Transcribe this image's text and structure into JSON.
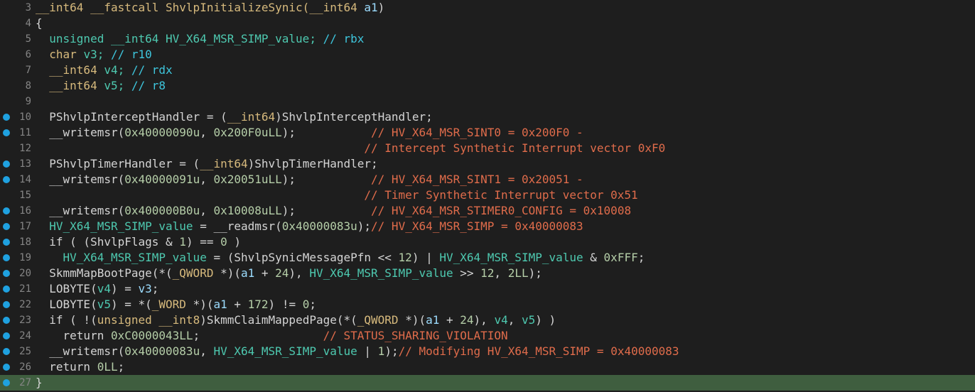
{
  "colors": {
    "background": "#1e1e1e",
    "line_number": "#858585",
    "breakpoint_dot": "#1fa1e0",
    "current_line_bg": "#3f5e3f",
    "plain": "#d4d4d4",
    "keyword": "#4ec9b0",
    "type": "#d7ba7d",
    "number": "#b5cea8",
    "comment_cyan": "#3ec6dd",
    "comment_orange": "#e06c4b",
    "global": "#2fb6e8",
    "variable": "#9cdcfe"
  },
  "icons": {
    "breakpoint": "breakpoint-dot-icon"
  },
  "lines": [
    {
      "num": "3",
      "bp": false,
      "hl": false,
      "tokens": [
        {
          "t": "__int64 __fastcall ShvlpInitializeSynic(",
          "c": "type"
        },
        {
          "t": "__int64 ",
          "c": "type"
        },
        {
          "t": "a1",
          "c": "variable"
        },
        {
          "t": ")",
          "c": "plain"
        }
      ]
    },
    {
      "num": "4",
      "bp": false,
      "hl": false,
      "tokens": [
        {
          "t": "{",
          "c": "plain"
        }
      ]
    },
    {
      "num": "5",
      "bp": false,
      "hl": false,
      "tokens": [
        {
          "t": "  unsigned __int64 HV_X64_MSR_SIMP_value; ",
          "c": "keyword"
        },
        {
          "t": "// rbx",
          "c": "comment_cyan"
        }
      ]
    },
    {
      "num": "6",
      "bp": false,
      "hl": false,
      "tokens": [
        {
          "t": "  char ",
          "c": "type"
        },
        {
          "t": "v3; ",
          "c": "keyword"
        },
        {
          "t": "// r10",
          "c": "comment_cyan"
        }
      ]
    },
    {
      "num": "7",
      "bp": false,
      "hl": false,
      "tokens": [
        {
          "t": "  __int64 ",
          "c": "type"
        },
        {
          "t": "v4; ",
          "c": "keyword"
        },
        {
          "t": "// rdx",
          "c": "comment_cyan"
        }
      ]
    },
    {
      "num": "8",
      "bp": false,
      "hl": false,
      "tokens": [
        {
          "t": "  __int64 ",
          "c": "type"
        },
        {
          "t": "v5; ",
          "c": "keyword"
        },
        {
          "t": "// r8",
          "c": "comment_cyan"
        }
      ]
    },
    {
      "num": "9",
      "bp": false,
      "hl": false,
      "tokens": []
    },
    {
      "num": "10",
      "bp": true,
      "hl": false,
      "tokens": [
        {
          "t": "  PShvlpInterceptHandler = (",
          "c": "plain"
        },
        {
          "t": "__int64",
          "c": "type"
        },
        {
          "t": ")ShvlpInterceptHandler;",
          "c": "plain"
        }
      ]
    },
    {
      "num": "11",
      "bp": true,
      "hl": false,
      "tokens": [
        {
          "t": "  __writemsr(",
          "c": "plain"
        },
        {
          "t": "0x40000090u",
          "c": "number"
        },
        {
          "t": ", ",
          "c": "plain"
        },
        {
          "t": "0x200F0uLL",
          "c": "number"
        },
        {
          "t": ");           ",
          "c": "plain"
        },
        {
          "t": "// HV_X64_MSR_SINT0 = 0x200F0 -",
          "c": "comment_orange"
        }
      ]
    },
    {
      "num": "12",
      "bp": false,
      "hl": false,
      "tokens": [
        {
          "t": "                                                ",
          "c": "plain"
        },
        {
          "t": "// Intercept Synthetic Interrupt vector 0xF0",
          "c": "comment_orange"
        }
      ]
    },
    {
      "num": "13",
      "bp": true,
      "hl": false,
      "tokens": [
        {
          "t": "  PShvlpTimerHandler = (",
          "c": "plain"
        },
        {
          "t": "__int64",
          "c": "type"
        },
        {
          "t": ")ShvlpTimerHandler;",
          "c": "plain"
        }
      ]
    },
    {
      "num": "14",
      "bp": true,
      "hl": false,
      "tokens": [
        {
          "t": "  __writemsr(",
          "c": "plain"
        },
        {
          "t": "0x40000091u",
          "c": "number"
        },
        {
          "t": ", ",
          "c": "plain"
        },
        {
          "t": "0x20051uLL",
          "c": "number"
        },
        {
          "t": ");           ",
          "c": "plain"
        },
        {
          "t": "// HV_X64_MSR_SINT1 = 0x20051 -",
          "c": "comment_orange"
        }
      ]
    },
    {
      "num": "15",
      "bp": false,
      "hl": false,
      "tokens": [
        {
          "t": "                                                ",
          "c": "plain"
        },
        {
          "t": "// Timer Synthetic Interrupt vector 0x51",
          "c": "comment_orange"
        }
      ]
    },
    {
      "num": "16",
      "bp": true,
      "hl": false,
      "tokens": [
        {
          "t": "  __writemsr(",
          "c": "plain"
        },
        {
          "t": "0x400000B0u",
          "c": "number"
        },
        {
          "t": ", ",
          "c": "plain"
        },
        {
          "t": "0x10008uLL",
          "c": "number"
        },
        {
          "t": ");           ",
          "c": "plain"
        },
        {
          "t": "// HV_X64_MSR_STIMER0_CONFIG = 0x10008",
          "c": "comment_orange"
        }
      ]
    },
    {
      "num": "17",
      "bp": true,
      "hl": false,
      "tokens": [
        {
          "t": "  HV_X64_MSR_SIMP_value",
          "c": "keyword"
        },
        {
          "t": " = __readmsr(",
          "c": "plain"
        },
        {
          "t": "0x40000083u",
          "c": "number"
        },
        {
          "t": ");",
          "c": "plain"
        },
        {
          "t": "// HV_X64_MSR_SIMP = 0x40000083",
          "c": "comment_orange"
        }
      ]
    },
    {
      "num": "18",
      "bp": true,
      "hl": false,
      "tokens": [
        {
          "t": "  if ( (ShvlpFlags & ",
          "c": "plain"
        },
        {
          "t": "1",
          "c": "number"
        },
        {
          "t": ") == ",
          "c": "plain"
        },
        {
          "t": "0",
          "c": "number"
        },
        {
          "t": " )",
          "c": "plain"
        }
      ]
    },
    {
      "num": "19",
      "bp": true,
      "hl": false,
      "tokens": [
        {
          "t": "    HV_X64_MSR_SIMP_value",
          "c": "keyword"
        },
        {
          "t": " = (ShvlpSynicMessagePfn << ",
          "c": "plain"
        },
        {
          "t": "12",
          "c": "number"
        },
        {
          "t": ") | ",
          "c": "plain"
        },
        {
          "t": "HV_X64_MSR_SIMP_value",
          "c": "keyword"
        },
        {
          "t": " & ",
          "c": "plain"
        },
        {
          "t": "0xFFF",
          "c": "number"
        },
        {
          "t": ";",
          "c": "plain"
        }
      ]
    },
    {
      "num": "20",
      "bp": true,
      "hl": false,
      "tokens": [
        {
          "t": "  SkmmMapBootPage(*(",
          "c": "plain"
        },
        {
          "t": "_QWORD",
          "c": "type"
        },
        {
          "t": " *)(",
          "c": "plain"
        },
        {
          "t": "a1",
          "c": "variable"
        },
        {
          "t": " + ",
          "c": "plain"
        },
        {
          "t": "24",
          "c": "number"
        },
        {
          "t": "), ",
          "c": "plain"
        },
        {
          "t": "HV_X64_MSR_SIMP_value",
          "c": "keyword"
        },
        {
          "t": " >> ",
          "c": "plain"
        },
        {
          "t": "12",
          "c": "number"
        },
        {
          "t": ", ",
          "c": "plain"
        },
        {
          "t": "2LL",
          "c": "number"
        },
        {
          "t": ");",
          "c": "plain"
        }
      ]
    },
    {
      "num": "21",
      "bp": true,
      "hl": false,
      "tokens": [
        {
          "t": "  LOBYTE(",
          "c": "plain"
        },
        {
          "t": "v4",
          "c": "keyword"
        },
        {
          "t": ") = ",
          "c": "plain"
        },
        {
          "t": "v3",
          "c": "variable"
        },
        {
          "t": ";",
          "c": "plain"
        }
      ]
    },
    {
      "num": "22",
      "bp": true,
      "hl": false,
      "tokens": [
        {
          "t": "  LOBYTE(",
          "c": "plain"
        },
        {
          "t": "v5",
          "c": "keyword"
        },
        {
          "t": ") = *(",
          "c": "plain"
        },
        {
          "t": "_WORD",
          "c": "type"
        },
        {
          "t": " *)(",
          "c": "plain"
        },
        {
          "t": "a1",
          "c": "variable"
        },
        {
          "t": " + ",
          "c": "plain"
        },
        {
          "t": "172",
          "c": "number"
        },
        {
          "t": ") != ",
          "c": "plain"
        },
        {
          "t": "0",
          "c": "number"
        },
        {
          "t": ";",
          "c": "plain"
        }
      ]
    },
    {
      "num": "23",
      "bp": true,
      "hl": false,
      "tokens": [
        {
          "t": "  if ( !(",
          "c": "plain"
        },
        {
          "t": "unsigned __int8",
          "c": "type"
        },
        {
          "t": ")SkmmClaimMappedPage(*(",
          "c": "plain"
        },
        {
          "t": "_QWORD",
          "c": "type"
        },
        {
          "t": " *)(",
          "c": "plain"
        },
        {
          "t": "a1",
          "c": "variable"
        },
        {
          "t": " + ",
          "c": "plain"
        },
        {
          "t": "24",
          "c": "number"
        },
        {
          "t": "), ",
          "c": "plain"
        },
        {
          "t": "v4",
          "c": "keyword"
        },
        {
          "t": ", ",
          "c": "plain"
        },
        {
          "t": "v5",
          "c": "keyword"
        },
        {
          "t": ") )",
          "c": "plain"
        }
      ]
    },
    {
      "num": "24",
      "bp": true,
      "hl": false,
      "tokens": [
        {
          "t": "    return ",
          "c": "plain"
        },
        {
          "t": "0xC0000043LL",
          "c": "number"
        },
        {
          "t": ";                  ",
          "c": "plain"
        },
        {
          "t": "// STATUS_SHARING_VIOLATION",
          "c": "comment_orange"
        }
      ]
    },
    {
      "num": "25",
      "bp": true,
      "hl": false,
      "tokens": [
        {
          "t": "  __writemsr(",
          "c": "plain"
        },
        {
          "t": "0x40000083u",
          "c": "number"
        },
        {
          "t": ", ",
          "c": "plain"
        },
        {
          "t": "HV_X64_MSR_SIMP_value",
          "c": "keyword"
        },
        {
          "t": " | ",
          "c": "plain"
        },
        {
          "t": "1",
          "c": "number"
        },
        {
          "t": ");",
          "c": "plain"
        },
        {
          "t": "// Modifying HV_X64_MSR_SIMP = 0x40000083",
          "c": "comment_orange"
        }
      ]
    },
    {
      "num": "26",
      "bp": true,
      "hl": false,
      "tokens": [
        {
          "t": "  return ",
          "c": "plain"
        },
        {
          "t": "0LL",
          "c": "number"
        },
        {
          "t": ";",
          "c": "plain"
        }
      ]
    },
    {
      "num": "27",
      "bp": true,
      "hl": true,
      "tokens": [
        {
          "t": "}",
          "c": "plain"
        }
      ]
    }
  ]
}
